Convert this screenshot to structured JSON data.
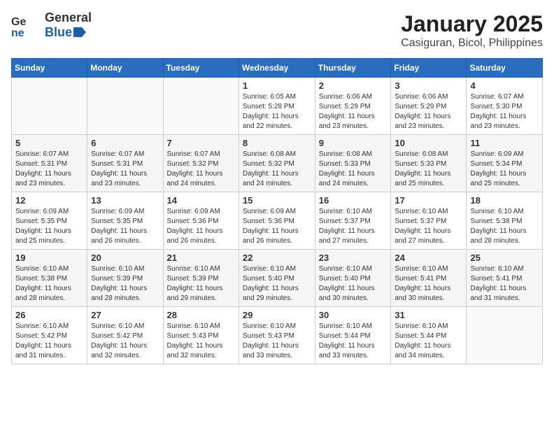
{
  "header": {
    "logo_general": "General",
    "logo_blue": "Blue",
    "month": "January 2025",
    "location": "Casiguran, Bicol, Philippines"
  },
  "weekdays": [
    "Sunday",
    "Monday",
    "Tuesday",
    "Wednesday",
    "Thursday",
    "Friday",
    "Saturday"
  ],
  "weeks": [
    [
      {
        "day": "",
        "text": ""
      },
      {
        "day": "",
        "text": ""
      },
      {
        "day": "",
        "text": ""
      },
      {
        "day": "1",
        "text": "Sunrise: 6:05 AM\nSunset: 5:28 PM\nDaylight: 11 hours\nand 22 minutes."
      },
      {
        "day": "2",
        "text": "Sunrise: 6:06 AM\nSunset: 5:29 PM\nDaylight: 11 hours\nand 23 minutes."
      },
      {
        "day": "3",
        "text": "Sunrise: 6:06 AM\nSunset: 5:29 PM\nDaylight: 11 hours\nand 23 minutes."
      },
      {
        "day": "4",
        "text": "Sunrise: 6:07 AM\nSunset: 5:30 PM\nDaylight: 11 hours\nand 23 minutes."
      }
    ],
    [
      {
        "day": "5",
        "text": "Sunrise: 6:07 AM\nSunset: 5:31 PM\nDaylight: 11 hours\nand 23 minutes."
      },
      {
        "day": "6",
        "text": "Sunrise: 6:07 AM\nSunset: 5:31 PM\nDaylight: 11 hours\nand 23 minutes."
      },
      {
        "day": "7",
        "text": "Sunrise: 6:07 AM\nSunset: 5:32 PM\nDaylight: 11 hours\nand 24 minutes."
      },
      {
        "day": "8",
        "text": "Sunrise: 6:08 AM\nSunset: 5:32 PM\nDaylight: 11 hours\nand 24 minutes."
      },
      {
        "day": "9",
        "text": "Sunrise: 6:08 AM\nSunset: 5:33 PM\nDaylight: 11 hours\nand 24 minutes."
      },
      {
        "day": "10",
        "text": "Sunrise: 6:08 AM\nSunset: 5:33 PM\nDaylight: 11 hours\nand 25 minutes."
      },
      {
        "day": "11",
        "text": "Sunrise: 6:09 AM\nSunset: 5:34 PM\nDaylight: 11 hours\nand 25 minutes."
      }
    ],
    [
      {
        "day": "12",
        "text": "Sunrise: 6:09 AM\nSunset: 5:35 PM\nDaylight: 11 hours\nand 25 minutes."
      },
      {
        "day": "13",
        "text": "Sunrise: 6:09 AM\nSunset: 5:35 PM\nDaylight: 11 hours\nand 26 minutes."
      },
      {
        "day": "14",
        "text": "Sunrise: 6:09 AM\nSunset: 5:36 PM\nDaylight: 11 hours\nand 26 minutes."
      },
      {
        "day": "15",
        "text": "Sunrise: 6:09 AM\nSunset: 5:36 PM\nDaylight: 11 hours\nand 26 minutes."
      },
      {
        "day": "16",
        "text": "Sunrise: 6:10 AM\nSunset: 5:37 PM\nDaylight: 11 hours\nand 27 minutes."
      },
      {
        "day": "17",
        "text": "Sunrise: 6:10 AM\nSunset: 5:37 PM\nDaylight: 11 hours\nand 27 minutes."
      },
      {
        "day": "18",
        "text": "Sunrise: 6:10 AM\nSunset: 5:38 PM\nDaylight: 11 hours\nand 28 minutes."
      }
    ],
    [
      {
        "day": "19",
        "text": "Sunrise: 6:10 AM\nSunset: 5:38 PM\nDaylight: 11 hours\nand 28 minutes."
      },
      {
        "day": "20",
        "text": "Sunrise: 6:10 AM\nSunset: 5:39 PM\nDaylight: 11 hours\nand 28 minutes."
      },
      {
        "day": "21",
        "text": "Sunrise: 6:10 AM\nSunset: 5:39 PM\nDaylight: 11 hours\nand 29 minutes."
      },
      {
        "day": "22",
        "text": "Sunrise: 6:10 AM\nSunset: 5:40 PM\nDaylight: 11 hours\nand 29 minutes."
      },
      {
        "day": "23",
        "text": "Sunrise: 6:10 AM\nSunset: 5:40 PM\nDaylight: 11 hours\nand 30 minutes."
      },
      {
        "day": "24",
        "text": "Sunrise: 6:10 AM\nSunset: 5:41 PM\nDaylight: 11 hours\nand 30 minutes."
      },
      {
        "day": "25",
        "text": "Sunrise: 6:10 AM\nSunset: 5:41 PM\nDaylight: 11 hours\nand 31 minutes."
      }
    ],
    [
      {
        "day": "26",
        "text": "Sunrise: 6:10 AM\nSunset: 5:42 PM\nDaylight: 11 hours\nand 31 minutes."
      },
      {
        "day": "27",
        "text": "Sunrise: 6:10 AM\nSunset: 5:42 PM\nDaylight: 11 hours\nand 32 minutes."
      },
      {
        "day": "28",
        "text": "Sunrise: 6:10 AM\nSunset: 5:43 PM\nDaylight: 11 hours\nand 32 minutes."
      },
      {
        "day": "29",
        "text": "Sunrise: 6:10 AM\nSunset: 5:43 PM\nDaylight: 11 hours\nand 33 minutes."
      },
      {
        "day": "30",
        "text": "Sunrise: 6:10 AM\nSunset: 5:44 PM\nDaylight: 11 hours\nand 33 minutes."
      },
      {
        "day": "31",
        "text": "Sunrise: 6:10 AM\nSunset: 5:44 PM\nDaylight: 11 hours\nand 34 minutes."
      },
      {
        "day": "",
        "text": ""
      }
    ]
  ]
}
